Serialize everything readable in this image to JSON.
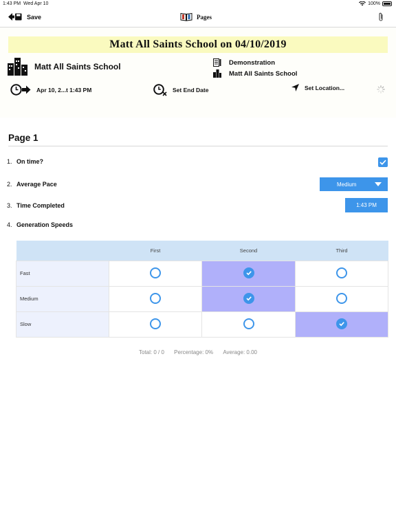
{
  "status": {
    "time": "1:43 PM",
    "date": "Wed Apr 10",
    "battery": "100%"
  },
  "nav": {
    "save_label": "Save",
    "title": "Pages"
  },
  "header": {
    "banner": "Matt All Saints School on 04/10/2019",
    "school_name": "Matt All Saints School",
    "form_name": "Demonstration",
    "location_name": "Matt All Saints School",
    "start_date": "Apr 10, 2...t 1:43 PM",
    "end_date_label": "Set End Date",
    "location_label": "Set Location..."
  },
  "page": {
    "title": "Page 1",
    "questions": [
      {
        "num": "1.",
        "label": "On time?",
        "checked": true
      },
      {
        "num": "2.",
        "label": "Average Pace",
        "value": "Medium"
      },
      {
        "num": "3.",
        "label": "Time Completed",
        "value": "1:43 PM"
      },
      {
        "num": "4.",
        "label": "Generation Speeds"
      }
    ]
  },
  "grid": {
    "columns": [
      "First",
      "Second",
      "Third"
    ],
    "rows": [
      {
        "label": "Fast",
        "selected": "Second"
      },
      {
        "label": "Medium",
        "selected": "Second"
      },
      {
        "label": "Slow",
        "selected": "Third"
      }
    ]
  },
  "summary": {
    "total": "Total: 0 / 0",
    "percentage": "Percentage: 0%",
    "average": "Average: 0.00"
  },
  "colors": {
    "accent": "#3d95ea",
    "banner": "#fafabf",
    "selected_cell": "#b0b0fa",
    "grid_header": "#cfe3f6"
  }
}
